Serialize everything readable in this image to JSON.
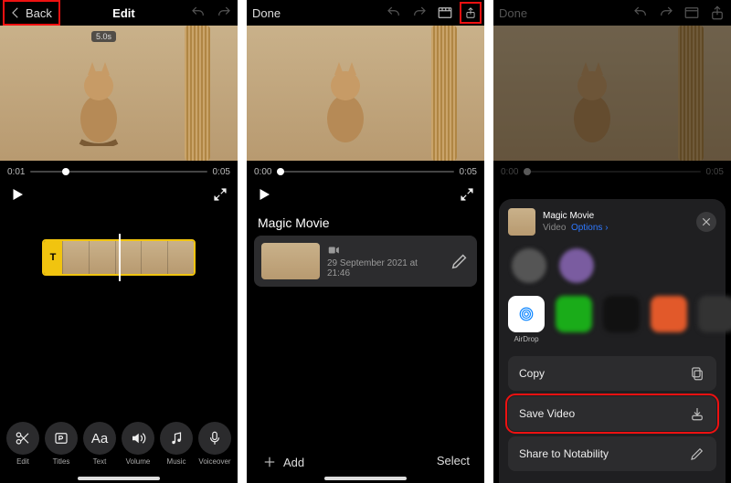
{
  "phone1": {
    "back_label": "Back",
    "title": "Edit",
    "clip_badge": "5.0s",
    "time_start": "0:01",
    "time_end": "0:05",
    "clip_text_tag": "T",
    "tools": {
      "edit": "Edit",
      "titles": "Titles",
      "text": "Text",
      "volume": "Volume",
      "music": "Music",
      "voiceover": "Voiceover"
    }
  },
  "phone2": {
    "done_label": "Done",
    "time_start": "0:00",
    "time_end": "0:05",
    "section": "Magic Movie",
    "project_date": "29 September 2021 at 21:46",
    "add_label": "Add",
    "select_label": "Select"
  },
  "phone3": {
    "done_label": "Done",
    "time_start": "0:00",
    "time_end": "0:05",
    "share": {
      "title": "Magic Movie",
      "subtitle_kind": "Video",
      "options_label": "Options",
      "airdrop_label": "AirDrop",
      "copy_label": "Copy",
      "save_video_label": "Save Video",
      "share_notability_label": "Share to Notability"
    }
  }
}
